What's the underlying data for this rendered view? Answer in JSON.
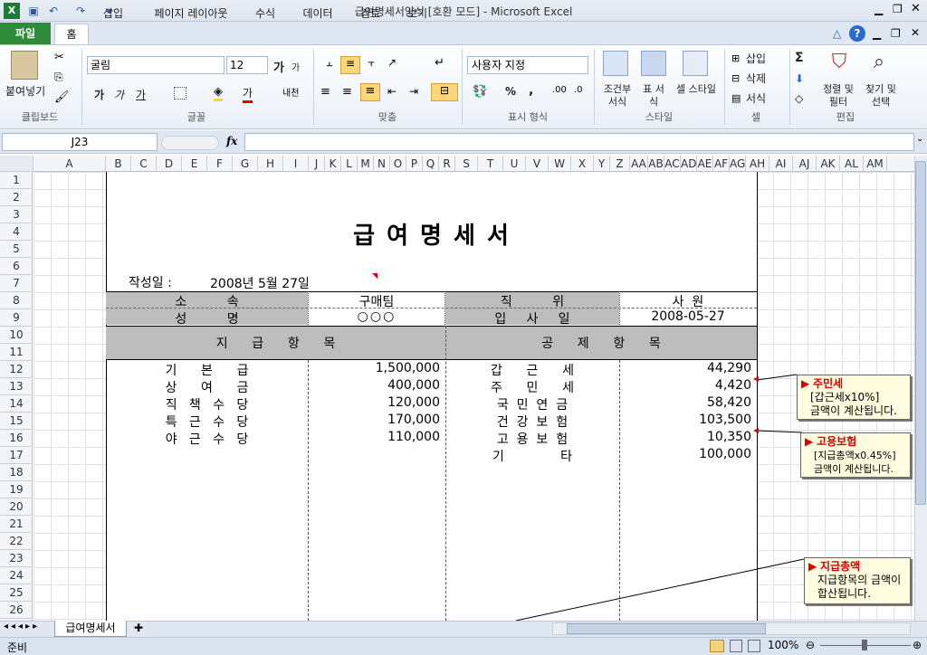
{
  "window": {
    "title": "급여명세서양식  [호환 모드]  -  Microsoft Excel"
  },
  "ribbon_tabs": [
    "파일",
    "홈",
    "삽입",
    "페이지 레이아웃",
    "수식",
    "데이터",
    "검토",
    "보기"
  ],
  "font": {
    "name": "굴림",
    "size": "12"
  },
  "number_format": "사용자 지정",
  "groups": [
    "클립보드",
    "글꼴",
    "맞춤",
    "표시 형식",
    "스타일",
    "셀",
    "편집"
  ],
  "buttons": {
    "paste": "붙여넣기",
    "cond_format": "조건부 서식",
    "table_format": "표 서식",
    "cell_style": "셀 스타일",
    "insert": "삽입",
    "delete": "삭제",
    "format": "서식",
    "sort_filter": "정렬 및 필터",
    "find_select": "찾기 및 선택",
    "grow": "가",
    "shrink": "가",
    "bold": "가",
    "italic": "가",
    "underline": "가",
    "fontcolor": "가",
    "wrap": "가↵",
    "pct": "%",
    "comma": ",",
    "sigma": "Σ"
  },
  "namebox": "J23",
  "fx": "fx",
  "columns": [
    "A",
    "B",
    "C",
    "D",
    "E",
    "F",
    "G",
    "H",
    "I",
    "J",
    "K",
    "L",
    "M",
    "N",
    "O",
    "P",
    "Q",
    "R",
    "S",
    "T",
    "U",
    "V",
    "W",
    "X",
    "Y",
    "Z",
    "AA",
    "AB",
    "AC",
    "AD",
    "AE",
    "AF",
    "AG",
    "AH",
    "AI",
    "AJ",
    "AK",
    "AL",
    "AM"
  ],
  "rows": [
    "1",
    "2",
    "3",
    "4",
    "5",
    "6",
    "7",
    "8",
    "9",
    "10",
    "11",
    "12",
    "13",
    "14",
    "15",
    "16",
    "17",
    "18",
    "19",
    "20",
    "21",
    "22",
    "23",
    "24",
    "25",
    "26"
  ],
  "doc": {
    "title": "급 여 명 세 서",
    "date_label": "작성일 :",
    "date_value": "2008년 5월 27일",
    "dept_label": "소          속",
    "dept_value": "구매팀",
    "name_label": "성          명",
    "name_value": "○○○",
    "pos_label": "직          위",
    "pos_value": "사  원",
    "join_label": "입     사     일",
    "join_value": "2008-05-27",
    "pay_header": "지      급      항      목",
    "ded_header": "공      제      항      목",
    "pay_items": [
      {
        "label": "기      본      급",
        "value": "1,500,000"
      },
      {
        "label": "상      여      금",
        "value": "400,000"
      },
      {
        "label": "직   책   수   당",
        "value": "120,000"
      },
      {
        "label": "특   근   수   당",
        "value": "170,000"
      },
      {
        "label": "야   근   수   당",
        "value": "110,000"
      }
    ],
    "ded_items": [
      {
        "label": "갑      근      세",
        "value": "44,290"
      },
      {
        "label": "주      민      세",
        "value": "4,420"
      },
      {
        "label": "국  민  연  금",
        "value": "58,420"
      },
      {
        "label": "건  강  보  험",
        "value": "103,500"
      },
      {
        "label": "고  용  보  험",
        "value": "10,350"
      },
      {
        "label": "기              타",
        "value": "100,000"
      }
    ]
  },
  "callouts": [
    {
      "title": "주민세",
      "line1": "[갑근세x10%]",
      "line2": "금액이 계산됩니다."
    },
    {
      "title": "고용보험",
      "line1": "[지급총액x0.45%]",
      "line2": "금액이 계산됩니다."
    },
    {
      "title": "지급총액",
      "line1": "지급항목의 금액이",
      "line2": "합산됩니다."
    }
  ],
  "sheet_tab": "급여명세서",
  "status": {
    "ready": "준비",
    "zoom": "100%"
  }
}
